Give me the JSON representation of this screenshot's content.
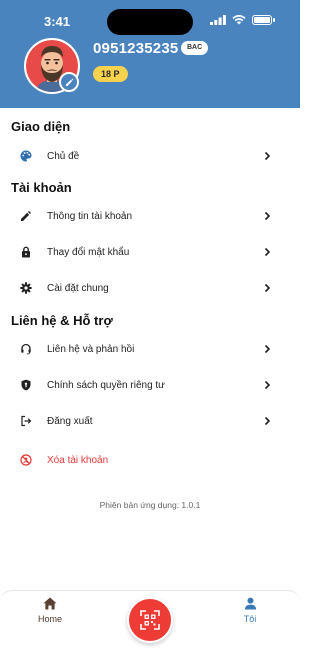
{
  "status_bar": {
    "time": "3:41"
  },
  "profile": {
    "phone": "0951235235",
    "rank": "BAC",
    "points": "18 P"
  },
  "sections": {
    "appearance": {
      "title": "Giao diện",
      "items": [
        {
          "label": "Chủ đề",
          "icon": "palette-icon"
        }
      ]
    },
    "account": {
      "title": "Tài khoản",
      "items": [
        {
          "label": "Thông tin tài khoản",
          "icon": "pencil-icon"
        },
        {
          "label": "Thay đổi mật khẩu",
          "icon": "lock-icon"
        },
        {
          "label": "Cài đặt chung",
          "icon": "gear-icon"
        }
      ]
    },
    "support": {
      "title": "Liên hệ & Hỗ trợ",
      "items": [
        {
          "label": "Liên hệ và phản hồi",
          "icon": "headset-icon"
        },
        {
          "label": "Chính sách quyền riêng tư",
          "icon": "shield-icon"
        },
        {
          "label": "Đăng xuất",
          "icon": "logout-icon"
        },
        {
          "label": "Xóa tài khoản",
          "icon": "delete-account-icon"
        }
      ]
    }
  },
  "version_text": "Phiên bản ứng dụng: 1.0.1",
  "bottom_nav": {
    "home_label": "Home",
    "me_label": "Tôi"
  },
  "colors": {
    "header": "#4a84bf",
    "points_badge": "#f7d24d",
    "qr_button": "#ef3b35",
    "danger": "#e53935",
    "active_tab": "#3a78b8"
  }
}
